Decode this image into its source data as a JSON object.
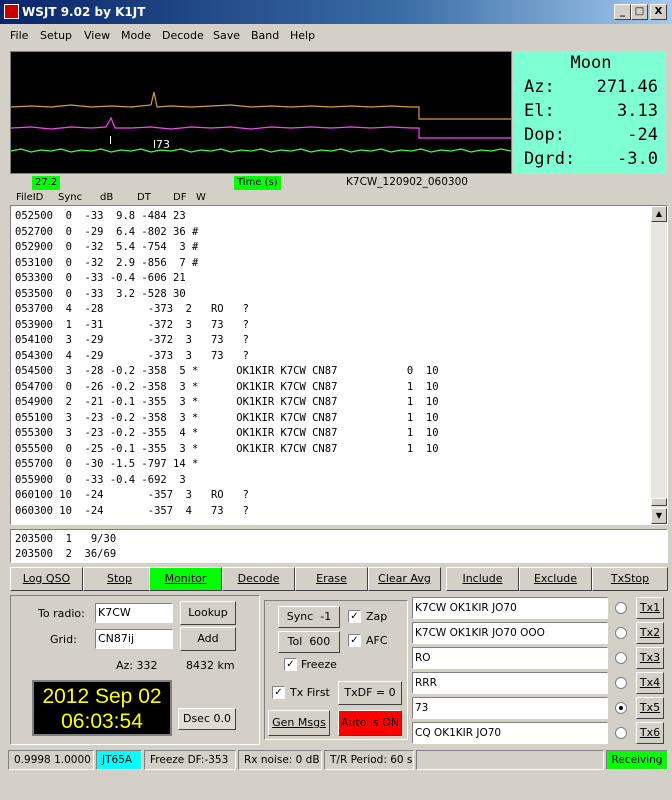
{
  "window": {
    "title": "WSJT 9.02    by K1JT",
    "min": "_",
    "max": "□",
    "close": "X"
  },
  "menu": [
    "File",
    "Setup",
    "View",
    "Mode",
    "Decode",
    "Save",
    "Band",
    "Help"
  ],
  "scope": {
    "scale_left": "27.2",
    "time_label": "Time (s)",
    "marker1": "l",
    "marker2": "l73"
  },
  "moon": {
    "title": "Moon",
    "az_label": "Az:",
    "az": "271.46",
    "el_label": "El:",
    "el": "3.13",
    "dop_label": "Dop:",
    "dop": "-24",
    "dgrd_label": "Dgrd:",
    "dgrd": "-3.0"
  },
  "filename": "K7CW_120902_060300",
  "columns": {
    "fileid": "FileID",
    "sync": "Sync",
    "db": "dB",
    "dt": "DT",
    "df": "DF",
    "w": "W"
  },
  "decodes": [
    "052500  0  -33  9.8 -484 23",
    "052700  0  -29  6.4 -802 36 #",
    "052900  0  -32  5.4 -754  3 #",
    "053100  0  -32  2.9 -856  7 #",
    "053300  0  -33 -0.4 -606 21",
    "053500  0  -33  3.2 -528 30",
    "053700  4  -28       -373  2   RO   ?",
    "053900  1  -31       -372  3   73   ?",
    "054100  3  -29       -372  3   73   ?",
    "054300  4  -29       -373  3   73   ?",
    "054500  3  -28 -0.2 -358  5 *      OK1KIR K7CW CN87           0  10",
    "054700  0  -26 -0.2 -358  3 *      OK1KIR K7CW CN87           1  10",
    "054900  2  -21 -0.1 -355  3 *      OK1KIR K7CW CN87           1  10",
    "055100  3  -23 -0.2 -358  3 *      OK1KIR K7CW CN87           1  10",
    "055300  3  -23 -0.2 -355  4 *      OK1KIR K7CW CN87           1  10",
    "055500  0  -25 -0.1 -355  3 *      OK1KIR K7CW CN87           1  10",
    "055700  0  -30 -1.5 -797 14 *",
    "055900  0  -33 -0.4 -692  3",
    "060100 10  -24       -357  3   RO   ?",
    "060300 10  -24       -357  4   73   ?"
  ],
  "averages": [
    "203500  1   9/30",
    "203500  2  36/69"
  ],
  "buttons": {
    "log_qso": "Log QSO",
    "stop": "Stop",
    "monitor": "Monitor",
    "decode": "Decode",
    "erase": "Erase",
    "clear_avg": "Clear Avg",
    "include": "Include",
    "exclude": "Exclude",
    "txstop": "TxStop"
  },
  "station": {
    "to_radio_label": "To radio:",
    "to_radio": "K7CW",
    "grid_label": "Grid:",
    "grid": "CN87ij",
    "lookup": "Lookup",
    "add": "Add",
    "az": "Az: 332",
    "dist": "8432 km",
    "date": "2012 Sep 02",
    "time": "06:03:54",
    "dsec_label": "Dsec",
    "dsec": "0.0"
  },
  "controls": {
    "sync_label": "Sync",
    "sync": "-1",
    "tol_label": "Tol",
    "tol": "600",
    "zap": "Zap",
    "afc": "AFC",
    "freeze": "Freeze",
    "txfirst": "Tx First",
    "txdf": "TxDF = 0",
    "genmsgs": "Gen Msgs",
    "auto": "Auto is  ON"
  },
  "tx": [
    {
      "msg": "K7CW OK1KIR JO70",
      "btn": "Tx1",
      "sel": false
    },
    {
      "msg": "K7CW OK1KIR JO70 OOO",
      "btn": "Tx2",
      "sel": false
    },
    {
      "msg": "RO",
      "btn": "Tx3",
      "sel": false
    },
    {
      "msg": "RRR",
      "btn": "Tx4",
      "sel": false
    },
    {
      "msg": "73",
      "btn": "Tx5",
      "sel": true
    },
    {
      "msg": "CQ OK1KIR JO70",
      "btn": "Tx6",
      "sel": false
    }
  ],
  "status": {
    "ratio": "0.9998 1.0000",
    "mode": "JT65A",
    "freeze_df": "Freeze DF:-353",
    "rx_noise": "Rx noise:  0 dB",
    "tr_period": "T/R Period: 60 s",
    "state": "Receiving"
  },
  "colors": {
    "monitor": "#00ff00",
    "moon_bg": "#7fffd4",
    "clock_fg": "#ffff00",
    "auto_on": "#ff0000",
    "mode_bg": "#00ffff"
  }
}
